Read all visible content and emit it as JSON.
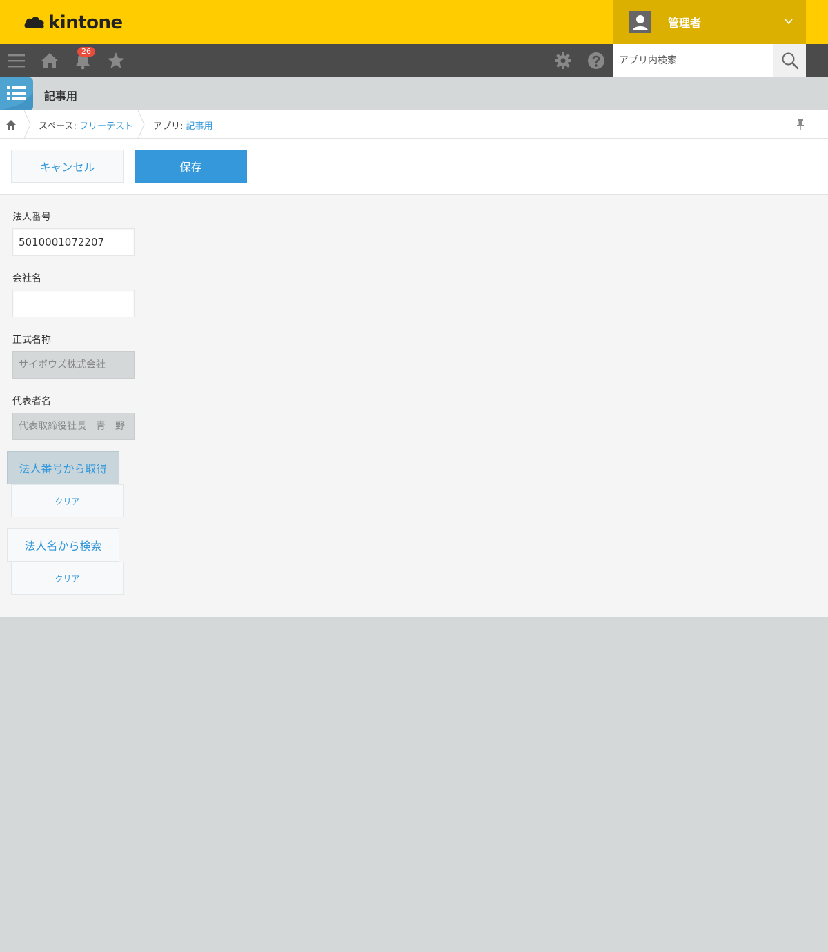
{
  "header": {
    "logo_text": "kintone",
    "user_name": "管理者"
  },
  "nav": {
    "notification_count": "26",
    "search_placeholder": "アプリ内検索"
  },
  "app": {
    "title": "記事用"
  },
  "breadcrumb": {
    "space_prefix": "スペース: ",
    "space_name": "フリーテスト",
    "app_prefix": "アプリ: ",
    "app_name": "記事用"
  },
  "toolbar": {
    "cancel_label": "キャンセル",
    "save_label": "保存"
  },
  "form": {
    "corp_number_label": "法人番号",
    "corp_number_value": "5010001072207",
    "company_name_label": "会社名",
    "company_name_value": "",
    "official_name_label": "正式名称",
    "official_name_value": "サイボウズ株式会社",
    "representative_label": "代表者名",
    "representative_value": "代表取締役社長　青　野",
    "fetch_by_number_label": "法人番号から取得",
    "clear_label_1": "クリア",
    "search_by_name_label": "法人名から検索",
    "clear_label_2": "クリア"
  },
  "colors": {
    "header_bg": "#ffcc00",
    "user_menu_bg": "#dbb000",
    "nav_bg": "#4b4b4b",
    "accent": "#3498db",
    "badge": "#e74c3c"
  }
}
